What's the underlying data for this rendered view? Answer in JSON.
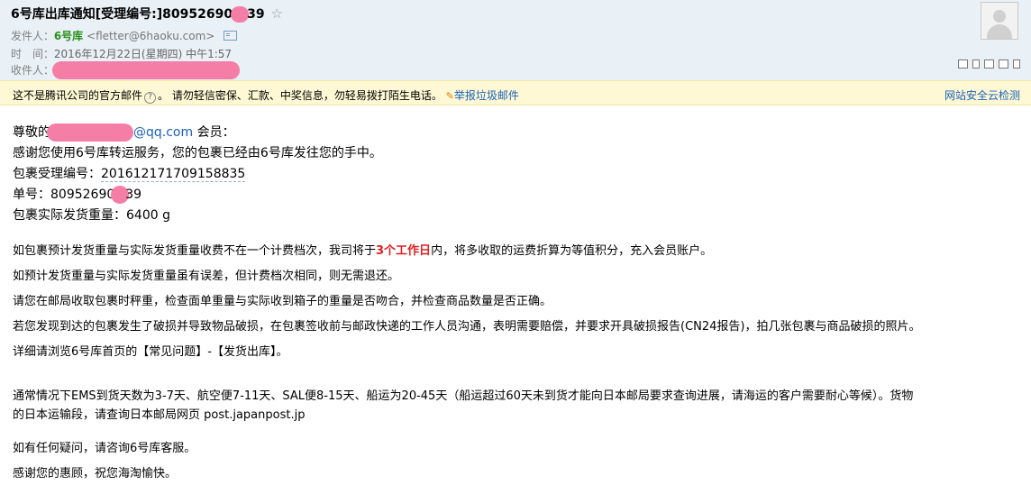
{
  "header": {
    "subject_prefix": "6号库出库通知[受理编号:]80952690",
    "subject_suffix": "39",
    "star": "☆",
    "sender_label": "发件人：",
    "sender_name": "6号库",
    "sender_address": "<fletter@6haoku.com>",
    "time_label": "时　间：",
    "time_value": "2016年12月22日(星期四) 中午1:57",
    "recipient_label": "收件人："
  },
  "warning": {
    "text1": "这不是腾讯公司的官方邮件",
    "qmark": "?",
    "text2": "。 请勿轻信密保、汇款、中奖信息，勿轻易拨打陌生电话。",
    "report_label": "举报垃圾邮件",
    "cloud_check": "网站安全云检测"
  },
  "body": {
    "greeting_prefix": "尊敬的",
    "greeting_email": "@qq.com",
    "greeting_suffix": " 会员：",
    "thanks_line": "感谢您使用6号库转运服务，您的包裹已经由6号库发往您的手中。",
    "receipt_label": "包裹受理编号：",
    "receipt_no": "201612171709158835",
    "order_label": "单号：",
    "order_prefix": "80952690",
    "order_suffix": "39",
    "weight_line": "包裹实际发货重量：6400 g",
    "para1a": "如包裹预计发货重量与实际发货重量收费不在一个计费档次，我司将于",
    "para1b": "3个工作日",
    "para1c": "内，将多收取的运费折算为等值积分，充入会员账户。",
    "para2": "如预计发货重量与实际发货重量虽有误差，但计费档次相同，则无需退还。",
    "para3": "请您在邮局收取包裹时秤重，检查面单重量与实际收到箱子的重量是否吻合，并检查商品数量是否正确。",
    "para4": "若您发现到达的包裹发生了破损并导致物品破损，在包裹签收前与邮政快递的工作人员沟通，表明需要赔偿，并要求开具破损报告(CN24报告)，拍几张包裹与商品破损的照片。",
    "para5": "详细请浏览6号库首页的【常见问题】-【发货出库】。",
    "para6a": "通常情况下EMS到货天数为3-7天、航空便7-11天、SAL便8-15天、船运为20-45天（船运超过60天未到货才能向日本邮局要求查询进展，请海运的客户需要耐心等候）。货物",
    "para6b": "的日本运输段，请查询日本邮局网页 post.japanpost.jp",
    "para7": "如有任何疑问，请咨询6号库客服。",
    "para8": "感谢您的惠顾，祝您海淘愉快。"
  },
  "colors": {
    "header_bg": "#e9f0f6",
    "warn_bg": "#fff8d4",
    "link": "#1a62bb",
    "sender": "#2a8f1d",
    "highlight": "#e02020",
    "redaction": "#f47ea5"
  }
}
